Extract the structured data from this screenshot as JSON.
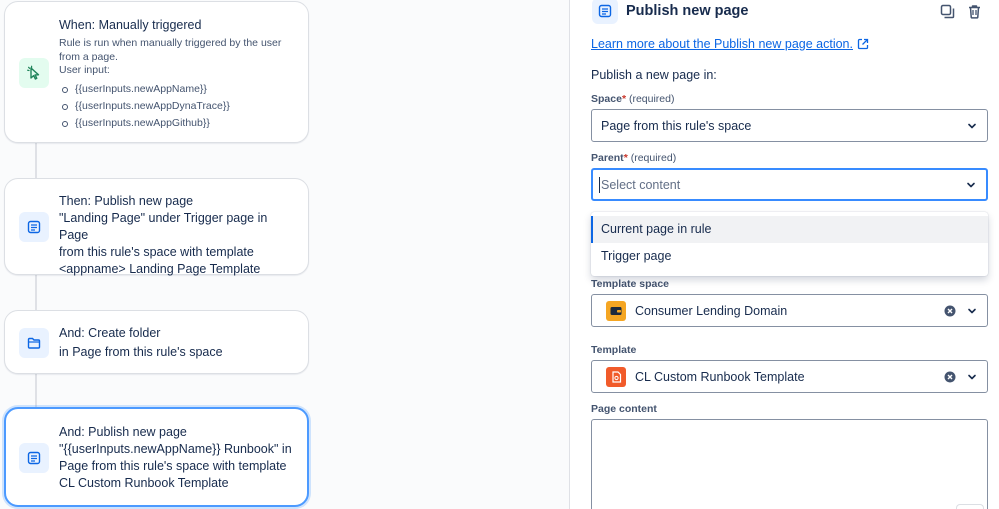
{
  "canvas": {
    "cards": [
      {
        "title": "When: Manually triggered",
        "description": "Rule is run when manually triggered by the user from a page.",
        "input_label": "User input:",
        "inputs": [
          "{{userInputs.newAppName}}",
          "{{userInputs.newAppDynaTrace}}",
          "{{userInputs.newAppGithub}}"
        ]
      },
      {
        "lines": [
          "Then: Publish new page",
          "\"Landing Page\" under Trigger page in Page",
          "from this rule's space with template",
          "<appname> Landing Page Template"
        ]
      },
      {
        "lines": [
          "And: Create folder",
          "in Page from this rule's space"
        ]
      },
      {
        "lines": [
          "And: Publish new page",
          "\"{{userInputs.newAppName}} Runbook\" in",
          "Page from this rule's space with template",
          "CL Custom Runbook Template"
        ]
      }
    ]
  },
  "panel": {
    "title": "Publish new page",
    "learn_more": "Learn more about the Publish new page action.",
    "section": "Publish a new page in:",
    "space": {
      "label": "Space",
      "required_mark": "*",
      "hint": "(required)",
      "value": "Page from this rule's space"
    },
    "parent": {
      "label": "Parent",
      "required_mark": "*",
      "hint": "(required)",
      "placeholder": "Select content",
      "options": [
        "Current page in rule",
        "Trigger page"
      ]
    },
    "template_space": {
      "label": "Template space",
      "value": "Consumer Lending Domain"
    },
    "template": {
      "label": "Template",
      "value": "CL Custom Runbook Template"
    },
    "page_content": {
      "label": "Page content"
    }
  },
  "colors": {
    "accent": "#0c66e4",
    "focus": "#388bff",
    "trigger_icon": "#1f845a",
    "space_chip": "#f5a623",
    "template_chip": "#f15b2a"
  }
}
